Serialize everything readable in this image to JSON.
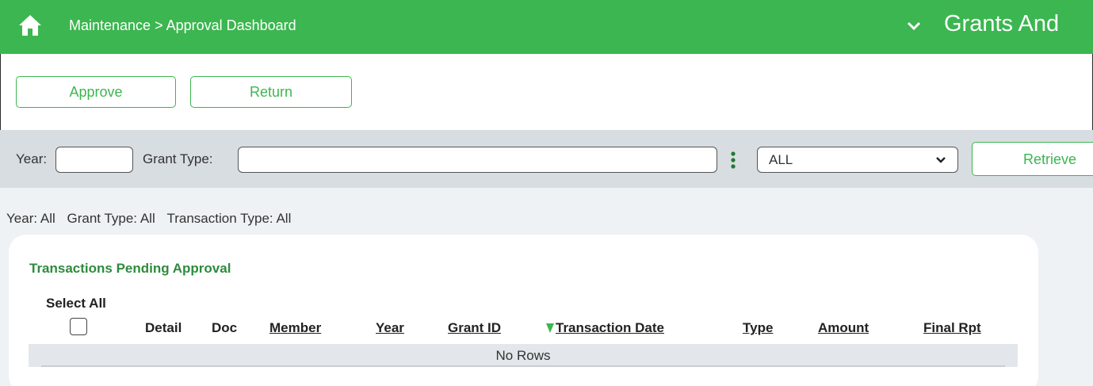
{
  "header": {
    "breadcrumb": "Maintenance > Approval Dashboard",
    "app_title": "Grants And",
    "home_icon": "home-icon",
    "chevron_icon": "chevron-down-icon"
  },
  "toolbar": {
    "approve_label": "Approve",
    "return_label": "Return"
  },
  "filters": {
    "year_label": "Year:",
    "year_value": "",
    "grant_type_label": "Grant Type:",
    "grant_type_value": "",
    "transaction_type_selected": "ALL",
    "retrieve_label": "Retrieve"
  },
  "summary": {
    "year_label": "Year:",
    "year_value": "All",
    "grant_type_label": "Grant Type:",
    "grant_type_value": "All",
    "transaction_type_label": "Transaction Type:",
    "transaction_type_value": "All"
  },
  "grid": {
    "title": "Transactions Pending Approval",
    "select_all_label": "Select All",
    "select_all_checked": false,
    "columns": [
      {
        "label": "Detail",
        "sortable": false
      },
      {
        "label": "Doc",
        "sortable": false
      },
      {
        "label": "Member",
        "sortable": true
      },
      {
        "label": "Year",
        "sortable": true
      },
      {
        "label": "Grant ID",
        "sortable": true
      },
      {
        "label": "Transaction Date",
        "sortable": true,
        "sorted": "descending"
      },
      {
        "label": "Type",
        "sortable": true
      },
      {
        "label": "Amount",
        "sortable": true
      },
      {
        "label": "Final Rpt",
        "sortable": true
      }
    ],
    "rows": [],
    "empty_message": "No Rows"
  },
  "colors": {
    "brand_green": "#3cb650",
    "title_green": "#2e8b3e",
    "filter_bg": "#d8dde2",
    "content_bg": "#eef2f5"
  }
}
